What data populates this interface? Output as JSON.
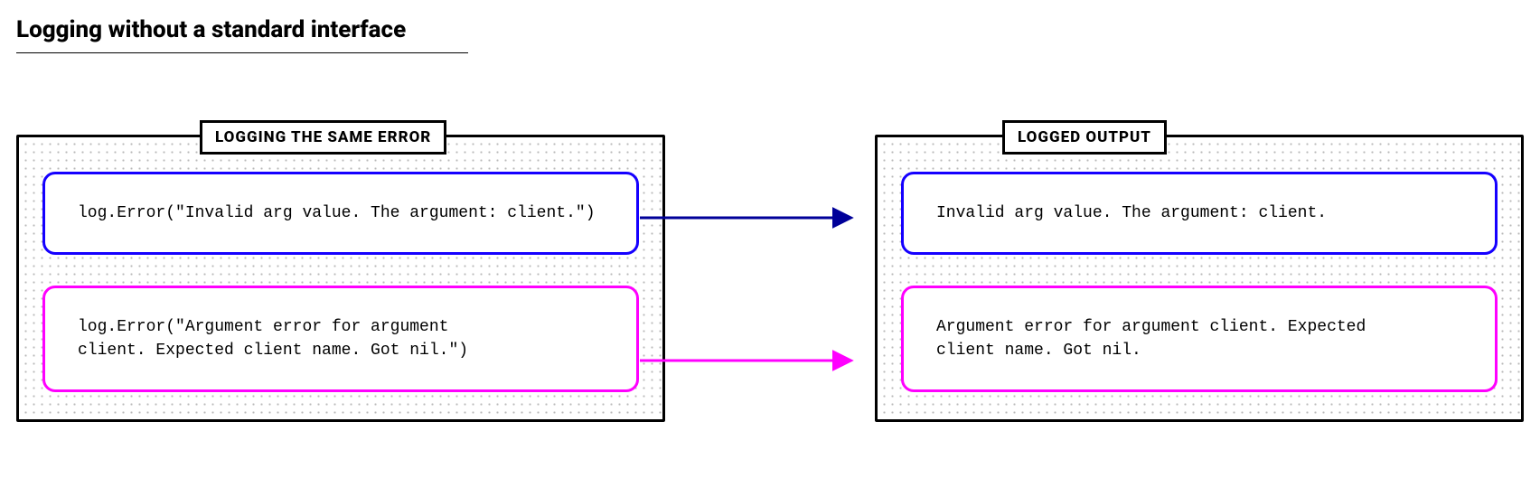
{
  "title": "Logging without a standard interface",
  "panels": {
    "left": {
      "label": "LOGGING THE SAME ERROR",
      "cards": [
        {
          "text": "log.Error(\"Invalid arg value. The argument: client.\")",
          "color": "blue"
        },
        {
          "text": "log.Error(\"Argument error for argument\nclient. Expected client name. Got nil.\")",
          "color": "magenta"
        }
      ]
    },
    "right": {
      "label": "LOGGED OUTPUT",
      "cards": [
        {
          "text": "Invalid arg value. The argument: client.",
          "color": "blue"
        },
        {
          "text": "Argument error for argument client. Expected\nclient name. Got nil.",
          "color": "magenta"
        }
      ]
    }
  },
  "arrows": [
    {
      "color": "#000099"
    },
    {
      "color": "#ff00ff"
    }
  ]
}
